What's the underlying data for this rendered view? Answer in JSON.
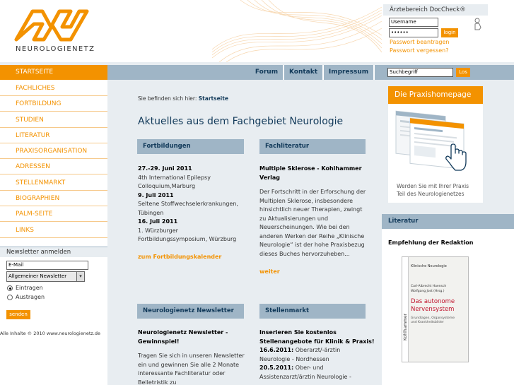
{
  "header": {
    "logo_text": "NEUROLOGIENETZ",
    "login": {
      "title": "Ärztebereich DocCheck®",
      "username_value": "Username",
      "password_value": "••••••",
      "login_label": "login",
      "forgot_1": "Passwort beantragen",
      "forgot_2": "Passwort vergessen?"
    }
  },
  "nav": {
    "start": "STARTSEITE",
    "tabs": [
      "Forum",
      "Kontakt",
      "Impressum"
    ],
    "search_value": "Suchbegriff",
    "search_button": "Los"
  },
  "sidebar": {
    "items": [
      "FACHLICHES",
      "FORTBILDUNG",
      "STUDIEN",
      "LITERATUR",
      "PRAXISORGANISATION",
      "ADRESSEN",
      "STELLENMARKT",
      "BIOGRAPHIEN",
      "PALM-SEITE",
      "LINKS"
    ],
    "newsletter": {
      "title": "Newsletter anmelden",
      "email_value": "E-Mail",
      "select_value": "Allgemeiner Newsletter",
      "radio_1": "Eintragen",
      "radio_2": "Austragen",
      "send_label": "senden"
    },
    "footer": "Alle Inhalte © 2010 www.neurologienetz.de"
  },
  "main": {
    "breadcrumb_prefix": "Sie befinden sich hier:",
    "breadcrumb_current": "Startseite",
    "title": "Aktuelles aus dem Fachgebiet Neurologie",
    "fortbildungen": {
      "head": "Fortbildungen",
      "d1": "27.-29. Juni 2011",
      "t1a": "4th International Epilepsy",
      "t1b": "Colloquium,Marburg",
      "d2": "9. Juli 2011",
      "t2a": "Seltene Stoffwechselerkrankungen,",
      "t2b": "Tübingen",
      "d3": "16. Juli 2011",
      "t3a": "1. Würzburger",
      "t3b": "Fortbildungssymposium, Würzburg",
      "link": "zum Fortbildungskalender"
    },
    "fachliteratur": {
      "head": "Fachliteratur",
      "title_a": "Multiple Sklerose - Kohlhammer",
      "title_b": "Verlag",
      "l1": "Der Fortschritt in der Erforschung der",
      "l2": "Multiplen Sklerose, insbesondere",
      "l3": "hinsichtlich neuer Therapien, zwingt",
      "l4": "zu Aktualisierungen und",
      "l5": "Neuerscheinungen. Wie bei den",
      "l6": "anderen Werken der Reihe „Klinische",
      "l7": "Neurologie“ ist der hohe Praxisbezug",
      "l8": "dieses Buches hervorzuheben...",
      "link": "weiter"
    },
    "newsletter_box": {
      "head": "Neurologienetz Newsletter",
      "title_a": "Neurologienetz Newsletter -",
      "title_b": "Gewinnspiel!",
      "l1": "Tragen Sie sich in unseren Newsletter",
      "l2": "ein und gewinnen Sie alle 2 Monate",
      "l3": "interessante Fachliteratur oder",
      "l4": "Belletristik zu"
    },
    "stellenmarkt": {
      "head": "Stellenmarkt",
      "title_a": "Inserieren Sie kostenlos",
      "title_b": "Stellenangebote für Klinik & Praxis!",
      "d1": "16.6.2011:",
      "t1a": " Oberarzt/-ärztin",
      "t1b": "Neurologie - Nordhessen",
      "d2": "20.5.2011:",
      "t2a": " Ober- und",
      "t2b": "Assistenzarzt/ärztin Neurologie -"
    }
  },
  "right": {
    "praxis_head": "Die Praxishomepage",
    "praxis_caption_1": "Werden Sie mit Ihrer Praxis",
    "praxis_caption_2": "Teil des Neurologienetzes",
    "lit_head": "Literatur",
    "lit_sub": "Empfehlung der Redaktion",
    "book_series": "Klinische Neurologie",
    "book_authors_1": "Carl-Albrecht Haensch",
    "book_authors_2": "Wolfgang Jost (Hrsg.)",
    "book_title_1": "Das autonome",
    "book_title_2": "Nervensystem",
    "book_sub_1": "Grundlagen, Organsysteme",
    "book_sub_2": "und Krankheitsbilder",
    "book_publisher": "Kohlhammer"
  },
  "colors": {
    "accent": "#f39200",
    "navy": "#123a5a",
    "nav_blue": "#9fb5c6",
    "panel": "#e8edf1"
  }
}
